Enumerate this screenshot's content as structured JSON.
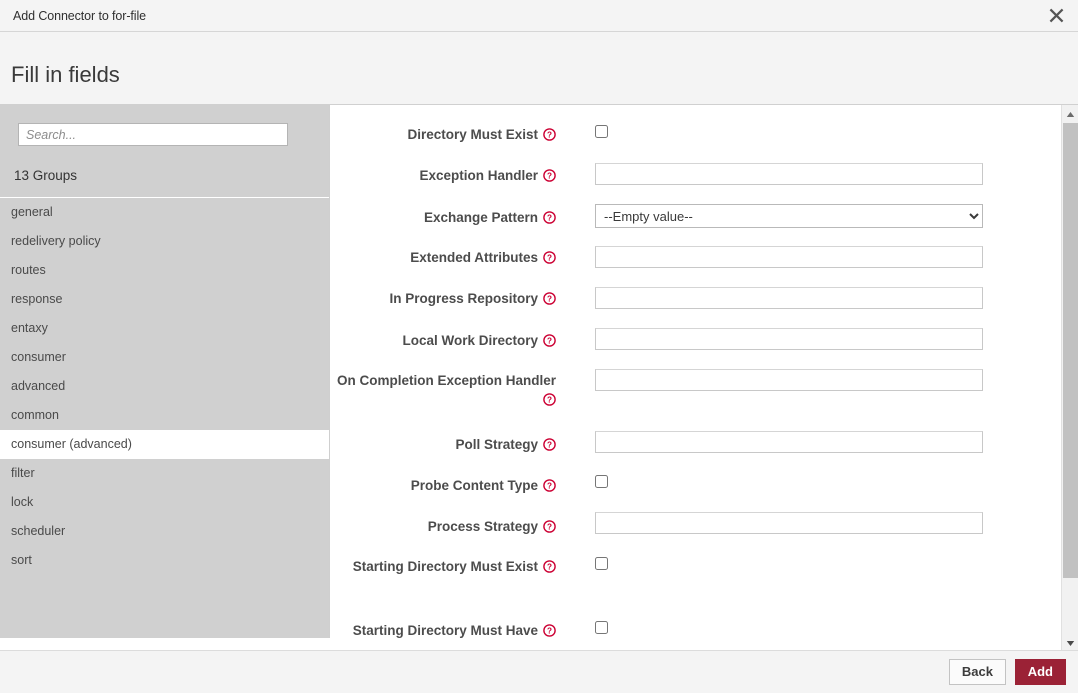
{
  "window": {
    "title": "Add Connector to for-file",
    "close_icon": "close-icon"
  },
  "heading": {
    "text": "Fill in fields"
  },
  "sidebar": {
    "search": {
      "placeholder": "Search...",
      "value": ""
    },
    "groups_count_label": "13 Groups",
    "items": [
      {
        "label": "general",
        "selected": false
      },
      {
        "label": "redelivery policy",
        "selected": false
      },
      {
        "label": "routes",
        "selected": false
      },
      {
        "label": "response",
        "selected": false
      },
      {
        "label": "entaxy",
        "selected": false
      },
      {
        "label": "consumer",
        "selected": false
      },
      {
        "label": "advanced",
        "selected": false
      },
      {
        "label": "common",
        "selected": false
      },
      {
        "label": "consumer (advanced)",
        "selected": true
      },
      {
        "label": "filter",
        "selected": false
      },
      {
        "label": "lock",
        "selected": false
      },
      {
        "label": "scheduler",
        "selected": false
      },
      {
        "label": "sort",
        "selected": false
      }
    ]
  },
  "form": {
    "help_icon": "help-circle-icon",
    "fields": [
      {
        "label": "Directory Must Exist",
        "type": "checkbox",
        "checked": false,
        "value": ""
      },
      {
        "label": "Exception Handler",
        "type": "text",
        "value": ""
      },
      {
        "label": "Exchange Pattern",
        "type": "select",
        "value": "--Empty value--",
        "options": [
          "--Empty value--"
        ]
      },
      {
        "label": "Extended Attributes",
        "type": "text",
        "value": ""
      },
      {
        "label": "In Progress Repository",
        "type": "text",
        "value": ""
      },
      {
        "label": "Local Work Directory",
        "type": "text",
        "value": ""
      },
      {
        "label": "On Completion Exception Handler",
        "type": "text",
        "value": ""
      },
      {
        "label": "Poll Strategy",
        "type": "text",
        "value": ""
      },
      {
        "label": "Probe Content Type",
        "type": "checkbox",
        "checked": false,
        "value": ""
      },
      {
        "label": "Process Strategy",
        "type": "text",
        "value": ""
      },
      {
        "label": "Starting Directory Must Exist",
        "type": "checkbox",
        "checked": false,
        "value": ""
      },
      {
        "label": "Starting Directory Must Have",
        "type": "checkbox",
        "checked": false,
        "value": ""
      }
    ]
  },
  "footer": {
    "back_label": "Back",
    "add_label": "Add"
  },
  "colors": {
    "accent": "#9b2236",
    "help_icon": "#cc0033",
    "sidebar_bg": "#d0d0d0",
    "chrome_bg": "#f4f4f4"
  },
  "scrollbar": {
    "up_icon": "chevron-up-icon",
    "down_icon": "chevron-down-icon"
  }
}
